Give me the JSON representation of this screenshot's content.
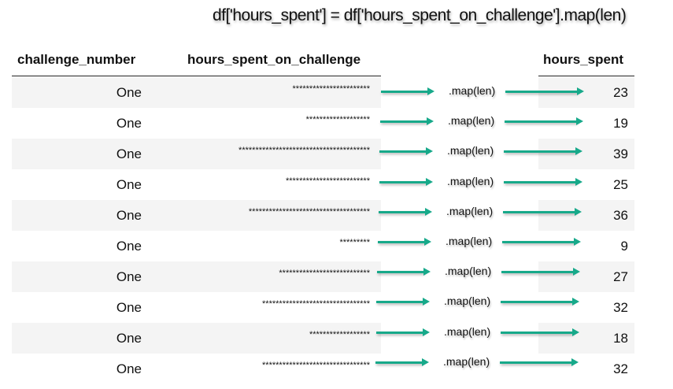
{
  "title": "df['hours_spent'] = df['hours_spent_on_challenge'].map(len)",
  "headers": {
    "challenge_number": "challenge_number",
    "hours_spent_on_challenge": "hours_spent_on_challenge",
    "hours_spent": "hours_spent"
  },
  "map_label": ".map(len)",
  "arrow_color": "#17a98a",
  "rows": [
    {
      "challenge_number": "One",
      "stars": "***********************",
      "hours": "23"
    },
    {
      "challenge_number": "One",
      "stars": "*******************",
      "hours": "19"
    },
    {
      "challenge_number": "One",
      "stars": "***************************************",
      "hours": "39"
    },
    {
      "challenge_number": "One",
      "stars": "*************************",
      "hours": "25"
    },
    {
      "challenge_number": "One",
      "stars": "************************************",
      "hours": "36"
    },
    {
      "challenge_number": "One",
      "stars": "*********",
      "hours": "9"
    },
    {
      "challenge_number": "One",
      "stars": "***************************",
      "hours": "27"
    },
    {
      "challenge_number": "One",
      "stars": "********************************",
      "hours": "32"
    },
    {
      "challenge_number": "One",
      "stars": "******************",
      "hours": "18"
    },
    {
      "challenge_number": "One",
      "stars": "********************************",
      "hours": "32"
    }
  ]
}
